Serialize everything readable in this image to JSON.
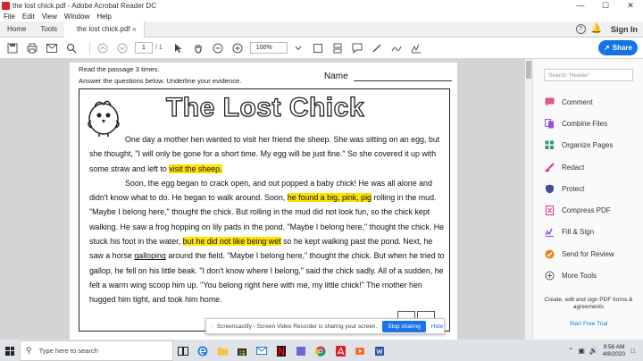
{
  "window": {
    "title": "the lost chick.pdf - Adobe Acrobat Reader DC",
    "controls": [
      "—",
      "☐",
      "✕"
    ]
  },
  "menu": [
    "File",
    "Edit",
    "View",
    "Window",
    "Help"
  ],
  "tabs": {
    "home": "Home",
    "tools": "Tools",
    "document": "the lost chick.pdf",
    "close": "×",
    "help": "?",
    "signin": "Sign In"
  },
  "toolbar": {
    "page_current": "1",
    "page_total": "/ 1",
    "zoom": "100%",
    "share": "Share"
  },
  "document": {
    "instruction_1": "Read the passage 3 times.",
    "instruction_2": "Answer the questions below. Underline your evidence.",
    "name_label": "Name",
    "title": "The Lost Chick",
    "para1": {
      "a": "One day a mother hen wanted to visit her friend the sheep. She was sitting on an egg, but she thought, \"I will only be gone for a short time. My egg will be just fine.\" So she covered it up with some straw and left to ",
      "hl": "visit the sheep."
    },
    "para2": {
      "a": "Soon, the egg began to crack open, and out popped a baby chick! He was all alone and didn't know what to do. He began to walk around. Soon, ",
      "hl1": "he found a big, pink, pig",
      "b": " rolling in the mud. \"Maybe I belong here,\" thought the chick. But rolling in the mud did not look fun, so the chick kept walking. He saw a frog hopping on lily pads in the pond. \"Maybe I belong here,\" thought the chick. He stuck his foot in the water, ",
      "hl2": "but he did not like being wet",
      "c": " so he kept walking past the pond. Next, he saw a horse ",
      "ul": "galloping",
      "d": " around the field. \"Maybe I belong here,\" thought the chick. But when he tried to gallop, he fell on his little beak. \"I don't know where I belong,\" said the chick sadly. All of a sudden, he felt a warm wing scoop him up. \"You belong right here with me, my little chick!\" The mother hen hugged him tight, and took him home."
    }
  },
  "sharing_bar": {
    "grip": "⦙",
    "message": "Screencastify - Screen Video Recorder is sharing your screen.",
    "stop": "Stop sharing",
    "hide": "Hide"
  },
  "right_panel": {
    "search_placeholder": "Search 'Header'",
    "tools": [
      {
        "label": "Comment",
        "icon": "comment-icon",
        "color": "#e8577e"
      },
      {
        "label": "Combine Files",
        "icon": "combine-files-icon",
        "color": "#9254de"
      },
      {
        "label": "Organize Pages",
        "icon": "organize-pages-icon",
        "color": "#2d9d78"
      },
      {
        "label": "Redact",
        "icon": "redact-icon",
        "color": "#d83790"
      },
      {
        "label": "Protect",
        "icon": "protect-icon",
        "color": "#4b4b9b"
      },
      {
        "label": "Compress PDF",
        "icon": "compress-pdf-icon",
        "color": "#d83790"
      },
      {
        "label": "Fill & Sign",
        "icon": "fill-sign-icon",
        "color": "#9254de"
      },
      {
        "label": "Send for Review",
        "icon": "send-review-icon",
        "color": "#e68619"
      },
      {
        "label": "More Tools",
        "icon": "more-tools-icon",
        "color": "#555555"
      }
    ],
    "promo": "Create, edit and sign PDF forms & agreements",
    "trial": "Start Free Trial"
  },
  "taskbar": {
    "search": "Type here to search",
    "time": "9:56 AM",
    "date": "4/8/2020"
  }
}
